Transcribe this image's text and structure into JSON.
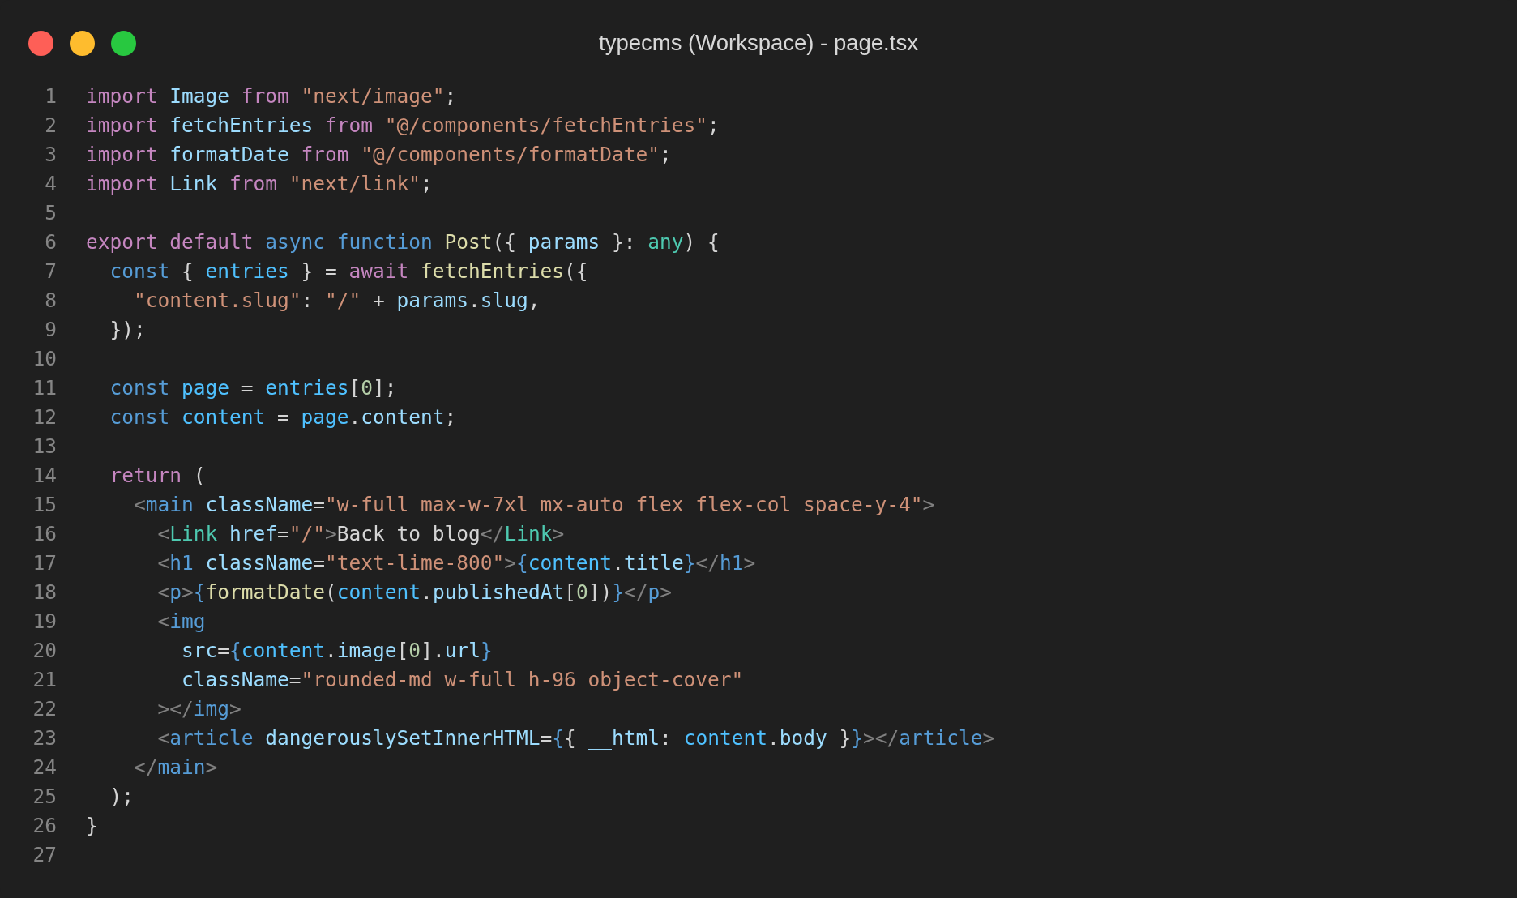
{
  "window": {
    "title": "typecms (Workspace) - page.tsx"
  },
  "editor": {
    "lines": [
      {
        "number": "1",
        "tokens": [
          {
            "text": "import",
            "kind": "keyword"
          },
          {
            "text": " Image",
            "kind": "variable"
          },
          {
            "text": " from ",
            "kind": "keyword"
          },
          {
            "text": "\"next/image\"",
            "kind": "string"
          },
          {
            "text": ";",
            "kind": "punct"
          }
        ]
      },
      {
        "number": "2",
        "tokens": [
          {
            "text": "import",
            "kind": "keyword"
          },
          {
            "text": " fetchEntries",
            "kind": "variable"
          },
          {
            "text": " from ",
            "kind": "keyword"
          },
          {
            "text": "\"@/components/fetchEntries\"",
            "kind": "string"
          },
          {
            "text": ";",
            "kind": "punct"
          }
        ]
      },
      {
        "number": "3",
        "tokens": [
          {
            "text": "import",
            "kind": "keyword"
          },
          {
            "text": " formatDate",
            "kind": "variable"
          },
          {
            "text": " from ",
            "kind": "keyword"
          },
          {
            "text": "\"@/components/formatDate\"",
            "kind": "string"
          },
          {
            "text": ";",
            "kind": "punct"
          }
        ]
      },
      {
        "number": "4",
        "tokens": [
          {
            "text": "import",
            "kind": "keyword"
          },
          {
            "text": " Link",
            "kind": "variable"
          },
          {
            "text": " from ",
            "kind": "keyword"
          },
          {
            "text": "\"next/link\"",
            "kind": "string"
          },
          {
            "text": ";",
            "kind": "punct"
          }
        ]
      },
      {
        "number": "5"
      },
      {
        "number": "6",
        "tokens": [
          {
            "text": "export default",
            "kind": "keyword"
          },
          {
            "text": " async function",
            "kind": "storage"
          },
          {
            "text": " Post",
            "kind": "function"
          },
          {
            "text": "({ ",
            "kind": "punct"
          },
          {
            "text": "params",
            "kind": "variable"
          },
          {
            "text": " }: ",
            "kind": "punct"
          },
          {
            "text": "any",
            "kind": "type"
          },
          {
            "text": ") {",
            "kind": "punct"
          }
        ]
      },
      {
        "number": "7",
        "tokens": [
          {
            "text": "  const",
            "kind": "storage"
          },
          {
            "text": " { ",
            "kind": "punct"
          },
          {
            "text": "entries",
            "kind": "constant"
          },
          {
            "text": " } = ",
            "kind": "punct"
          },
          {
            "text": "await",
            "kind": "keyword"
          },
          {
            "text": " fetchEntries",
            "kind": "function"
          },
          {
            "text": "({",
            "kind": "punct"
          }
        ]
      },
      {
        "number": "8",
        "tokens": [
          {
            "text": "    \"content.slug\"",
            "kind": "string"
          },
          {
            "text": ": ",
            "kind": "punct"
          },
          {
            "text": "\"/\"",
            "kind": "string"
          },
          {
            "text": " + ",
            "kind": "punct"
          },
          {
            "text": "params",
            "kind": "variable"
          },
          {
            "text": ".",
            "kind": "punct"
          },
          {
            "text": "slug",
            "kind": "variable"
          },
          {
            "text": ",",
            "kind": "punct"
          }
        ]
      },
      {
        "number": "9",
        "tokens": [
          {
            "text": "  });",
            "kind": "punct"
          }
        ]
      },
      {
        "number": "10"
      },
      {
        "number": "11",
        "tokens": [
          {
            "text": "  const",
            "kind": "storage"
          },
          {
            "text": " page",
            "kind": "constant"
          },
          {
            "text": " = ",
            "kind": "punct"
          },
          {
            "text": "entries",
            "kind": "constant"
          },
          {
            "text": "[",
            "kind": "punct"
          },
          {
            "text": "0",
            "kind": "number"
          },
          {
            "text": "];",
            "kind": "punct"
          }
        ]
      },
      {
        "number": "12",
        "tokens": [
          {
            "text": "  const",
            "kind": "storage"
          },
          {
            "text": " content",
            "kind": "constant"
          },
          {
            "text": " = ",
            "kind": "punct"
          },
          {
            "text": "page",
            "kind": "constant"
          },
          {
            "text": ".",
            "kind": "punct"
          },
          {
            "text": "content",
            "kind": "variable"
          },
          {
            "text": ";",
            "kind": "punct"
          }
        ]
      },
      {
        "number": "13"
      },
      {
        "number": "14",
        "tokens": [
          {
            "text": "  return",
            "kind": "keyword"
          },
          {
            "text": " (",
            "kind": "punct"
          }
        ]
      },
      {
        "number": "15",
        "tokens": [
          {
            "text": "    <",
            "kind": "bracket"
          },
          {
            "text": "main",
            "kind": "tag"
          },
          {
            "text": " className",
            "kind": "variable"
          },
          {
            "text": "=",
            "kind": "punct"
          },
          {
            "text": "\"w-full max-w-7xl mx-auto flex flex-col space-y-4\"",
            "kind": "string"
          },
          {
            "text": ">",
            "kind": "bracket"
          }
        ]
      },
      {
        "number": "16",
        "tokens": [
          {
            "text": "      <",
            "kind": "bracket"
          },
          {
            "text": "Link",
            "kind": "type"
          },
          {
            "text": " href",
            "kind": "variable"
          },
          {
            "text": "=",
            "kind": "punct"
          },
          {
            "text": "\"/\"",
            "kind": "string"
          },
          {
            "text": ">",
            "kind": "bracket"
          },
          {
            "text": "Back to blog",
            "kind": "punct"
          },
          {
            "text": "</",
            "kind": "bracket"
          },
          {
            "text": "Link",
            "kind": "type"
          },
          {
            "text": ">",
            "kind": "bracket"
          }
        ]
      },
      {
        "number": "17",
        "tokens": [
          {
            "text": "      <",
            "kind": "bracket"
          },
          {
            "text": "h1",
            "kind": "tag"
          },
          {
            "text": " className",
            "kind": "variable"
          },
          {
            "text": "=",
            "kind": "punct"
          },
          {
            "text": "\"text-lime-800\"",
            "kind": "string"
          },
          {
            "text": ">",
            "kind": "bracket"
          },
          {
            "text": "{",
            "kind": "brace"
          },
          {
            "text": "content",
            "kind": "constant"
          },
          {
            "text": ".",
            "kind": "punct"
          },
          {
            "text": "title",
            "kind": "variable"
          },
          {
            "text": "}",
            "kind": "brace"
          },
          {
            "text": "</",
            "kind": "bracket"
          },
          {
            "text": "h1",
            "kind": "tag"
          },
          {
            "text": ">",
            "kind": "bracket"
          }
        ]
      },
      {
        "number": "18",
        "tokens": [
          {
            "text": "      <",
            "kind": "bracket"
          },
          {
            "text": "p",
            "kind": "tag"
          },
          {
            "text": ">",
            "kind": "bracket"
          },
          {
            "text": "{",
            "kind": "brace"
          },
          {
            "text": "formatDate",
            "kind": "function"
          },
          {
            "text": "(",
            "kind": "punct"
          },
          {
            "text": "content",
            "kind": "constant"
          },
          {
            "text": ".",
            "kind": "punct"
          },
          {
            "text": "publishedAt",
            "kind": "variable"
          },
          {
            "text": "[",
            "kind": "punct"
          },
          {
            "text": "0",
            "kind": "number"
          },
          {
            "text": "])",
            "kind": "punct"
          },
          {
            "text": "}",
            "kind": "brace"
          },
          {
            "text": "</",
            "kind": "bracket"
          },
          {
            "text": "p",
            "kind": "tag"
          },
          {
            "text": ">",
            "kind": "bracket"
          }
        ]
      },
      {
        "number": "19",
        "tokens": [
          {
            "text": "      <",
            "kind": "bracket"
          },
          {
            "text": "img",
            "kind": "tag"
          }
        ]
      },
      {
        "number": "20",
        "tokens": [
          {
            "text": "        src",
            "kind": "variable"
          },
          {
            "text": "=",
            "kind": "punct"
          },
          {
            "text": "{",
            "kind": "brace"
          },
          {
            "text": "content",
            "kind": "constant"
          },
          {
            "text": ".",
            "kind": "punct"
          },
          {
            "text": "image",
            "kind": "variable"
          },
          {
            "text": "[",
            "kind": "punct"
          },
          {
            "text": "0",
            "kind": "number"
          },
          {
            "text": "].",
            "kind": "punct"
          },
          {
            "text": "url",
            "kind": "variable"
          },
          {
            "text": "}",
            "kind": "brace"
          }
        ]
      },
      {
        "number": "21",
        "tokens": [
          {
            "text": "        className",
            "kind": "variable"
          },
          {
            "text": "=",
            "kind": "punct"
          },
          {
            "text": "\"rounded-md w-full h-96 object-cover\"",
            "kind": "string"
          }
        ]
      },
      {
        "number": "22",
        "tokens": [
          {
            "text": "      ></",
            "kind": "bracket"
          },
          {
            "text": "img",
            "kind": "tag"
          },
          {
            "text": ">",
            "kind": "bracket"
          }
        ]
      },
      {
        "number": "23",
        "tokens": [
          {
            "text": "      <",
            "kind": "bracket"
          },
          {
            "text": "article",
            "kind": "tag"
          },
          {
            "text": " dangerouslySetInnerHTML",
            "kind": "variable"
          },
          {
            "text": "=",
            "kind": "punct"
          },
          {
            "text": "{",
            "kind": "brace"
          },
          {
            "text": "{ ",
            "kind": "punct"
          },
          {
            "text": "__html",
            "kind": "variable"
          },
          {
            "text": ": ",
            "kind": "punct"
          },
          {
            "text": "content",
            "kind": "constant"
          },
          {
            "text": ".",
            "kind": "punct"
          },
          {
            "text": "body",
            "kind": "variable"
          },
          {
            "text": " }",
            "kind": "punct"
          },
          {
            "text": "}",
            "kind": "brace"
          },
          {
            "text": "></",
            "kind": "bracket"
          },
          {
            "text": "article",
            "kind": "tag"
          },
          {
            "text": ">",
            "kind": "bracket"
          }
        ]
      },
      {
        "number": "24",
        "tokens": [
          {
            "text": "    </",
            "kind": "bracket"
          },
          {
            "text": "main",
            "kind": "tag"
          },
          {
            "text": ">",
            "kind": "bracket"
          }
        ]
      },
      {
        "number": "25",
        "tokens": [
          {
            "text": "  );",
            "kind": "punct"
          }
        ]
      },
      {
        "number": "26",
        "tokens": [
          {
            "text": "}",
            "kind": "punct"
          }
        ]
      },
      {
        "number": "27"
      }
    ]
  }
}
